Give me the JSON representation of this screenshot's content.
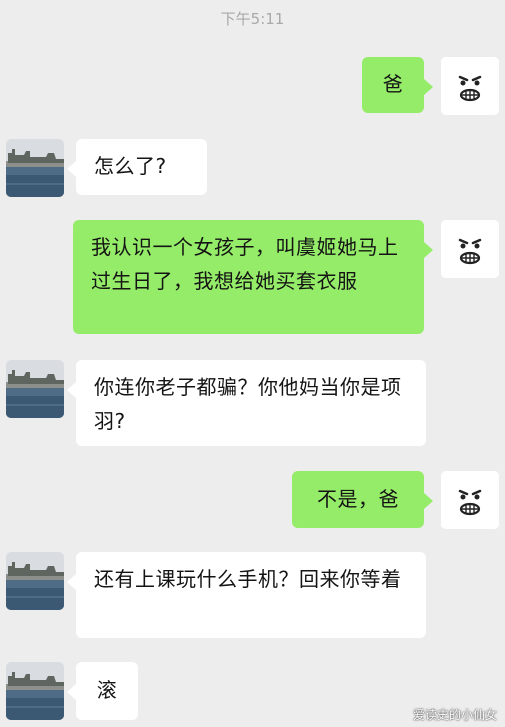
{
  "chat": {
    "time": "下午5:11",
    "messages": [
      {
        "side": "right",
        "text": "爸"
      },
      {
        "side": "left",
        "text": "怎么了?"
      },
      {
        "side": "right",
        "text": "我认识一个女孩子，叫虞姬她马上过生日了，我想给她买套衣服"
      },
      {
        "side": "left",
        "text": "你连你老子都骗？你他妈当你是项羽?"
      },
      {
        "side": "right",
        "text": "不是，爸"
      },
      {
        "side": "left",
        "text": "还有上课玩什么手机？回来你等着"
      },
      {
        "side": "left",
        "text": "滚"
      }
    ]
  },
  "watermark": "爱读史的小仙女",
  "icons": {
    "left_avatar": "harbor-photo-avatar",
    "right_avatar": "grinning-face-avatar"
  },
  "colors": {
    "background": "#ededed",
    "sent_bubble": "#95ec69",
    "received_bubble": "#ffffff",
    "time_text": "#a9a9a9"
  }
}
